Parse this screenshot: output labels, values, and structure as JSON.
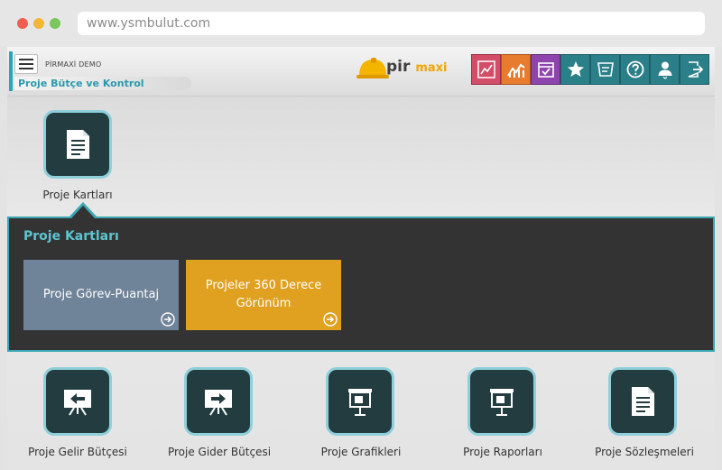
{
  "browser": {
    "url": "www.ysmbulut.com"
  },
  "header": {
    "company": "PİRMAXİ DEMO",
    "module": "Proje Bütçe ve Kontrol",
    "logo_text": "pir",
    "logo_text_accent": "maxi"
  },
  "toolbar": [
    {
      "icon": "dashboard-chart-icon",
      "color": "#d24d67"
    },
    {
      "icon": "trend-chart-icon",
      "color": "#e77c2e"
    },
    {
      "icon": "calendar-check-icon",
      "color": "#8e44ad"
    },
    {
      "icon": "star-icon",
      "color": "#2b7f88"
    },
    {
      "icon": "message-icon",
      "color": "#2b7f88"
    },
    {
      "icon": "help-icon",
      "color": "#2b7f88"
    },
    {
      "icon": "user-icon",
      "color": "#2b7f88"
    },
    {
      "icon": "logout-icon",
      "color": "#2b7f88"
    }
  ],
  "top_tile": {
    "label": "Proje Kartları",
    "icon": "document-icon"
  },
  "panel": {
    "title": "Proje Kartları",
    "cards": [
      {
        "label": "Proje Görev-Puantaj",
        "color": "#6f8399"
      },
      {
        "label": "Projeler 360 Derece Görünüm",
        "color": "#e0a020"
      }
    ]
  },
  "bottom_tiles": [
    {
      "label": "Proje Gelir Bütçesi",
      "icon": "income-board-icon"
    },
    {
      "label": "Proje Gider Bütçesi",
      "icon": "expense-board-icon"
    },
    {
      "label": "Proje Grafikleri",
      "icon": "chart-board-icon"
    },
    {
      "label": "Proje Raporları",
      "icon": "report-board-icon"
    },
    {
      "label": "Proje Sözleşmeleri",
      "icon": "contract-document-icon"
    }
  ]
}
